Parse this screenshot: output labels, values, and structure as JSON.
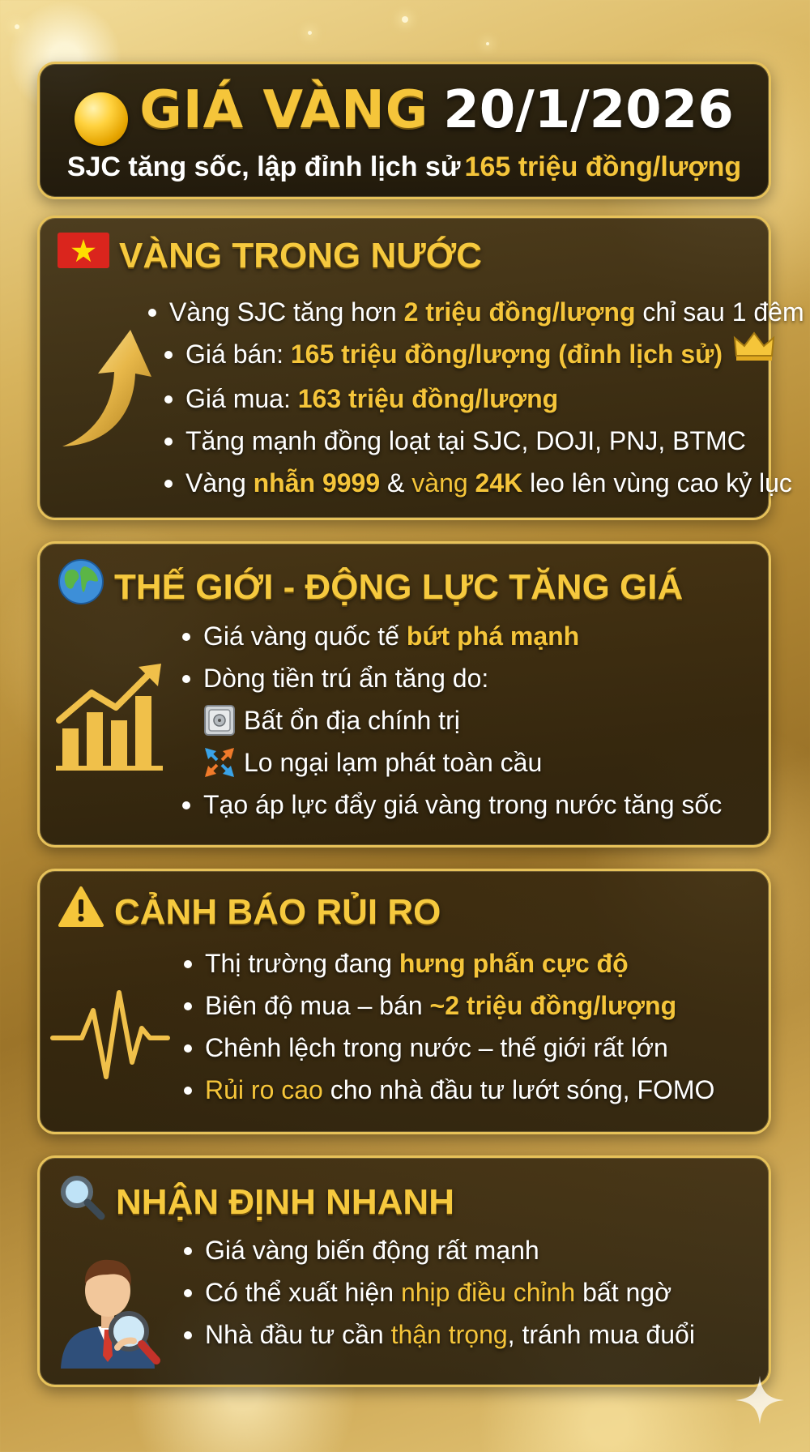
{
  "header": {
    "title_gold": "GIÁ VÀNG",
    "title_date": "20/1/2026",
    "subtitle_white": "SJC tăng sốc, lập đỉnh lịch sử",
    "subtitle_gold": "165 triệu đồng/lượng"
  },
  "domestic": {
    "title": "VÀNG TRONG NƯỚC",
    "flag_icon": "vietnam-flag-icon",
    "side_icon": "up-arrow-icon",
    "items": [
      {
        "a": "Vàng SJC tăng hơn ",
        "b": "2 triệu đồng/lượng",
        "c": " chỉ sau 1 đêm"
      },
      {
        "a": "Giá bán: ",
        "b": "165 triệu đồng/lượng (đỉnh lịch sử)",
        "c": ""
      },
      {
        "a": "Giá mua: ",
        "b": "163 triệu đồng/lượng",
        "c": ""
      },
      {
        "a": "Tăng mạnh đồng loạt tại SJC, DOJI, PNJ, BTMC",
        "b": "",
        "c": ""
      },
      {
        "a": "Vàng ",
        "b": "nhẫn 9999",
        "c": " & ",
        "d": "vàng ",
        "e": "24K",
        "f": " leo lên vùng cao kỷ lục"
      }
    ]
  },
  "world": {
    "title": "THẾ GIỚI - ĐỘNG LỰC TĂNG GIÁ",
    "globe_icon": "globe-icon",
    "side_icon": "rising-bar-chart-icon",
    "items": [
      {
        "a": "Giá vàng quốc tế ",
        "b": "bứt phá mạnh"
      },
      {
        "a": "Dòng tiền trú ẩn tăng do:"
      },
      {
        "a": "Bất ổn địa chính trị",
        "icon": "safe-icon"
      },
      {
        "a": "Lo ngại lạm phát toàn cầu",
        "icon": "compress-arrows-icon"
      },
      {
        "a": "Tạo áp lực đẩy giá vàng trong nước tăng sốc"
      }
    ]
  },
  "risk": {
    "title": "CẢNH BÁO RỦI RO",
    "warning_icon": "warning-icon",
    "side_icon": "heartbeat-line-icon",
    "items": [
      {
        "a": "Thị trường đang ",
        "b": "hưng phấn cực độ"
      },
      {
        "a": "Biên độ mua – bán ",
        "b": "~2 triệu đồng/lượng"
      },
      {
        "a": "Chênh lệch trong nước – thế giới rất lớn"
      },
      {
        "b": "Rủi ro cao",
        "a": " cho nhà đầu tư lướt sóng, FOMO"
      }
    ]
  },
  "outlook": {
    "title": "NHẬN ĐỊNH NHANH",
    "magnifier_icon": "magnifier-icon",
    "side_icon": "analyst-person-icon",
    "items": [
      {
        "a": "Giá vàng biến động rất mạnh"
      },
      {
        "a": "Có thể xuất hiện ",
        "b": "nhịp điều chỉnh",
        "c": " bất ngờ"
      },
      {
        "a": "Nhà đầu tư cần ",
        "b": "thận trọng",
        "c": ", tránh mua đuổi"
      }
    ]
  },
  "colors": {
    "accent_gold": "#f5c53a",
    "panel_border": "#e7c25a",
    "panel_bg": "#1e1608"
  }
}
